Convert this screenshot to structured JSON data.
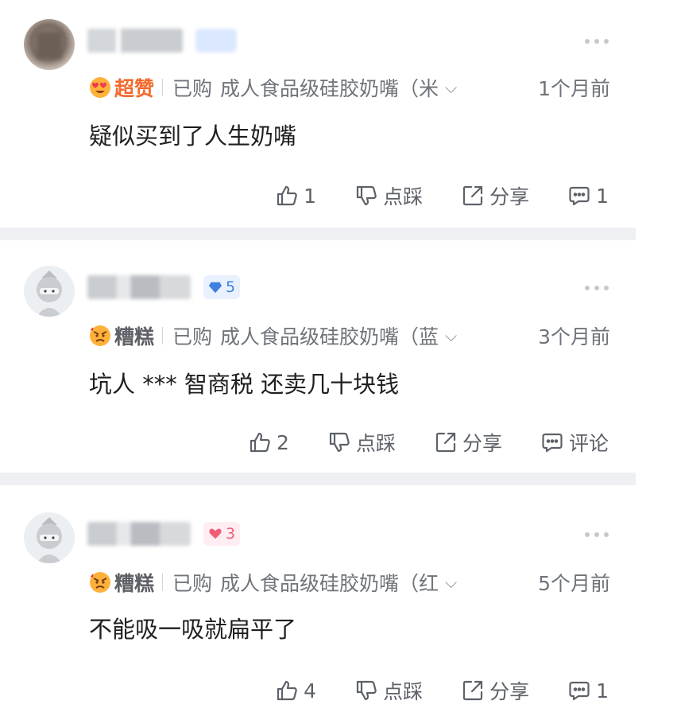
{
  "reviews": [
    {
      "rating_label": "超赞",
      "purchased_label": "已购",
      "product_spec": "成人食品级硅胶奶嘴（米",
      "time": "1个月前",
      "text": "疑似买到了人生奶嘴",
      "like_count": "1",
      "dislike_label": "点踩",
      "share_label": "分享",
      "comment_label": "1"
    },
    {
      "level_badge": "5",
      "rating_label": "糟糕",
      "purchased_label": "已购",
      "product_spec": "成人食品级硅胶奶嘴（蓝",
      "time": "3个月前",
      "text": "坑人 *** 智商税 还卖几十块钱",
      "like_count": "2",
      "dislike_label": "点踩",
      "share_label": "分享",
      "comment_label": "评论"
    },
    {
      "level_badge": "3",
      "rating_label": "糟糕",
      "purchased_label": "已购",
      "product_spec": "成人食品级硅胶奶嘴（红",
      "time": "5个月前",
      "text": "不能吸一吸就扁平了",
      "like_count": "4",
      "dislike_label": "点踩",
      "share_label": "分享",
      "comment_label": "1"
    }
  ],
  "icons": {
    "good_rating": "heart-eyes-face-icon",
    "bad_rating": "angry-face-icon",
    "like": "thumbs-up-icon",
    "dislike": "thumbs-down-icon",
    "share": "share-icon",
    "comment": "comment-bubble-icon",
    "more": "more-dots-icon",
    "level": "diamond-icon",
    "heart": "heart-icon"
  },
  "colors": {
    "good_rating": "#f26a2c",
    "level_badge": "#3f7fe0",
    "heart_badge": "#f15c77",
    "divider": "#eef0f3"
  }
}
